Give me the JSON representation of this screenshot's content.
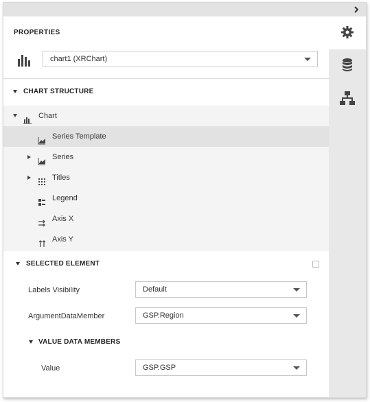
{
  "properties": {
    "title": "PROPERTIES",
    "chart_selector_value": "chart1 (XRChart)"
  },
  "chart_structure": {
    "title": "CHART STRUCTURE",
    "items": [
      {
        "label": "Chart"
      },
      {
        "label": "Series Template"
      },
      {
        "label": "Series"
      },
      {
        "label": "Titles"
      },
      {
        "label": "Legend"
      },
      {
        "label": "Axis X"
      },
      {
        "label": "Axis Y"
      }
    ]
  },
  "selected_element": {
    "title": "SELECTED ELEMENT",
    "labels_visibility": {
      "label": "Labels Visibility",
      "value": "Default"
    },
    "argument_data_member": {
      "label": "ArgumentDataMember",
      "value": "GSP.Region"
    },
    "value_data_members": {
      "title": "VALUE DATA MEMBERS",
      "value": {
        "label": "Value",
        "value": "GSP.GSP"
      }
    }
  },
  "side_tabs": [
    {
      "icon": "gear-icon"
    },
    {
      "icon": "database-icon"
    },
    {
      "icon": "hierarchy-icon"
    }
  ]
}
